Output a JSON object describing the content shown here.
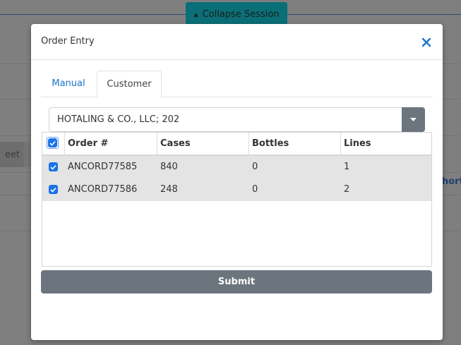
{
  "background": {
    "collapse_label": "Collapse Session",
    "partial_button_label": "eet",
    "partial_link_label": "hort"
  },
  "modal": {
    "title": "Order Entry",
    "tabs": [
      {
        "label": "Manual",
        "active": false
      },
      {
        "label": "Customer",
        "active": true
      }
    ],
    "customer_select": {
      "value": "HOTALING & CO., LLC; 202"
    },
    "table": {
      "select_all_checked": true,
      "columns": [
        "Order #",
        "Cases",
        "Bottles",
        "Lines"
      ],
      "rows": [
        {
          "checked": true,
          "order": "ANCORD77585",
          "cases": "840",
          "bottles": "0",
          "lines": "1"
        },
        {
          "checked": true,
          "order": "ANCORD77586",
          "cases": "248",
          "bottles": "0",
          "lines": "2"
        }
      ]
    },
    "submit_label": "Submit"
  },
  "colors": {
    "accent": "#1a73e8",
    "submit_bg": "#6c757d",
    "row_bg": "#e4e4e4",
    "collapse_bg": "#0a6f77"
  }
}
